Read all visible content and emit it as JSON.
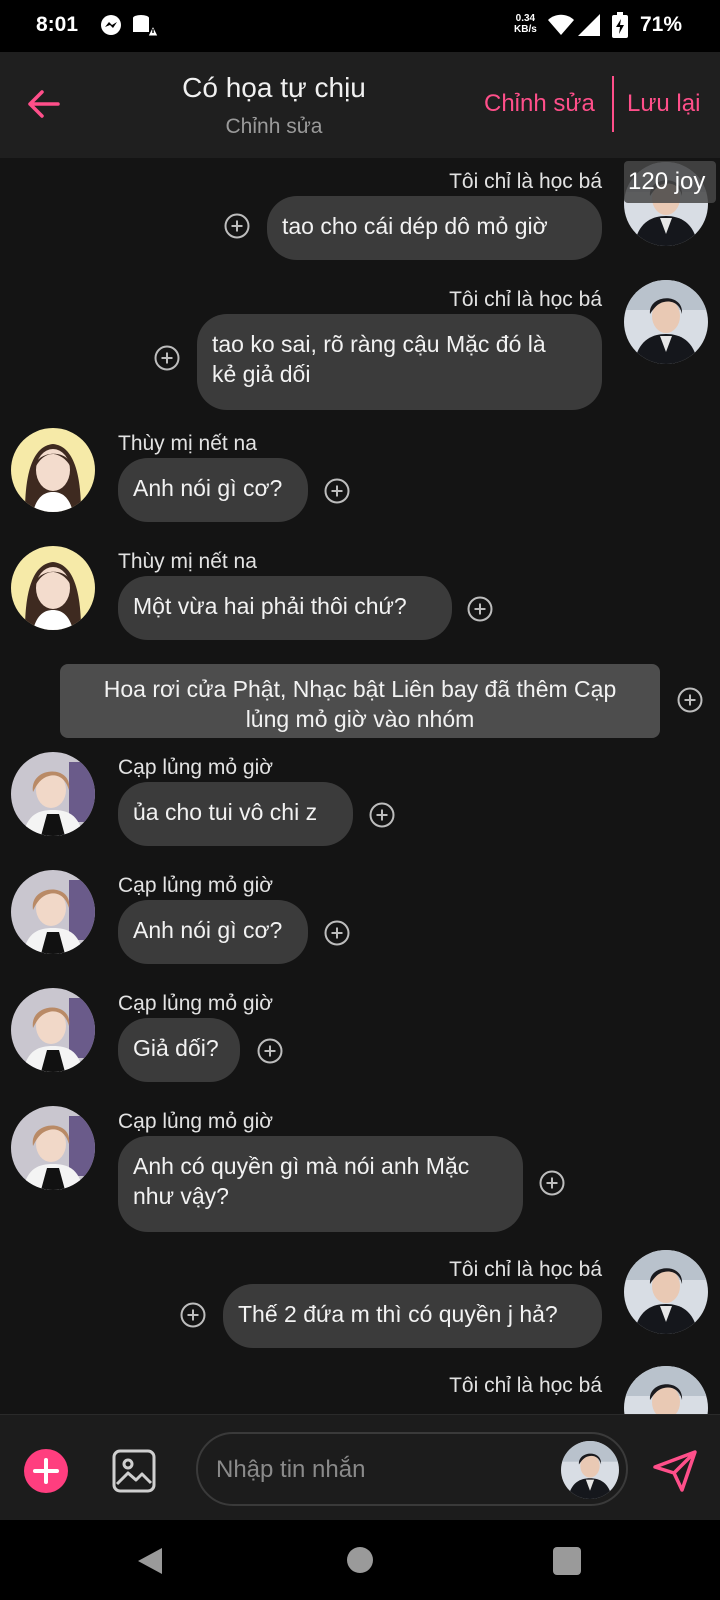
{
  "status_bar": {
    "time": "8:01",
    "net_speed_value": "0.34",
    "net_speed_unit": "KB/s",
    "battery": "71%",
    "icons": [
      "messenger-icon",
      "database-alert-icon",
      "wifi-icon",
      "signal-icon",
      "battery-charging-icon"
    ]
  },
  "header": {
    "title": "Có họa tự chịu",
    "subtitle": "Chỉnh sửa",
    "edit_label": "Chỉnh sửa",
    "save_label": "Lưu lại"
  },
  "badge": {
    "joy": "120 joy"
  },
  "messages": [
    {
      "side": "right",
      "sender": "Tôi chỉ là học bá",
      "lines": [
        "tao cho cái dép dô mỏ giờ"
      ]
    },
    {
      "side": "right",
      "sender": "Tôi chỉ là học bá",
      "lines": [
        "tao ko sai, rõ ràng cậu Mặc đó là",
        "kẻ giả dối"
      ]
    },
    {
      "side": "left",
      "sender": "Thùy mị nết na",
      "lines": [
        "Anh nói gì cơ?"
      ]
    },
    {
      "side": "left",
      "sender": "Thùy mị nết na",
      "lines": [
        "Một vừa hai phải thôi chứ?"
      ]
    },
    {
      "side": "system",
      "lines": [
        "Hoa rơi cửa Phật, Nhạc bật Liên bay đã thêm Cạp",
        "lủng mỏ giờ vào nhóm"
      ]
    },
    {
      "side": "left",
      "sender": "Cạp lủng mỏ giờ",
      "lines": [
        "ủa cho tui vô chi z"
      ]
    },
    {
      "side": "left",
      "sender": "Cạp lủng mỏ giờ",
      "lines": [
        "Anh nói gì cơ?"
      ]
    },
    {
      "side": "left",
      "sender": "Cạp lủng mỏ giờ",
      "lines": [
        "Giả dối?"
      ]
    },
    {
      "side": "left",
      "sender": "Cạp lủng mỏ giờ",
      "lines": [
        "Anh có quyền gì mà nói anh Mặc",
        "như vậy?"
      ]
    },
    {
      "side": "right",
      "sender": "Tôi chỉ là học bá",
      "lines": [
        "Thế 2 đứa m thì có quyền j hả?"
      ]
    },
    {
      "side": "right",
      "sender": "Tôi chỉ là học bá",
      "lines": []
    }
  ],
  "input": {
    "placeholder": "Nhập tin nhắn"
  },
  "colors": {
    "accent": "#ff4f8a",
    "bubble": "#3b3b3b",
    "background": "#141414"
  }
}
